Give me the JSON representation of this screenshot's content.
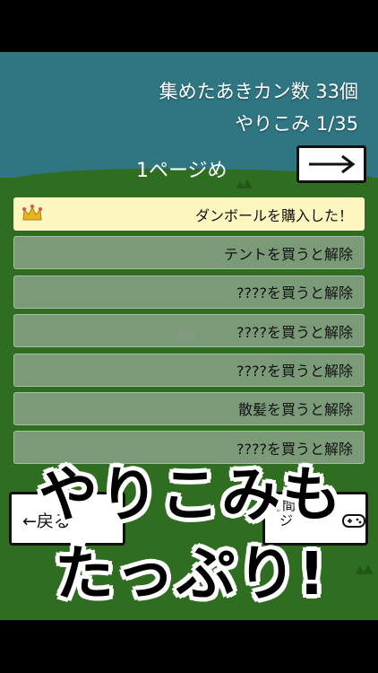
{
  "header": {
    "cans_collected": "集めたあきカン数 33個",
    "achievements": "やりこみ 1/35"
  },
  "pager": {
    "page_label": "1ページめ",
    "next_label": "→"
  },
  "achievement_list": [
    {
      "text": "ダンボールを購入した！",
      "unlocked": true
    },
    {
      "text": "テントを買うと解除",
      "unlocked": false
    },
    {
      "text": "????を買うと解除",
      "unlocked": false
    },
    {
      "text": "????を買うと解除",
      "unlocked": false
    },
    {
      "text": "????を買うと解除",
      "unlocked": false
    },
    {
      "text": "散髪を買うと解除",
      "unlocked": false
    },
    {
      "text": "????を買うと解除",
      "unlocked": false
    }
  ],
  "bottom_left": {
    "back_label": "←戻る"
  },
  "bottom_right": {
    "time_label": "時間",
    "time_sub": "ジ"
  },
  "promo": {
    "line1": "やりこみも",
    "line2": "たっぷり!"
  },
  "colors": {
    "sky": "#2f7582",
    "grass": "#2f6e21",
    "unlocked_row": "#fdf7bf"
  },
  "icons": [
    "crown-icon",
    "right-arrow-icon",
    "gamepad-icon"
  ]
}
